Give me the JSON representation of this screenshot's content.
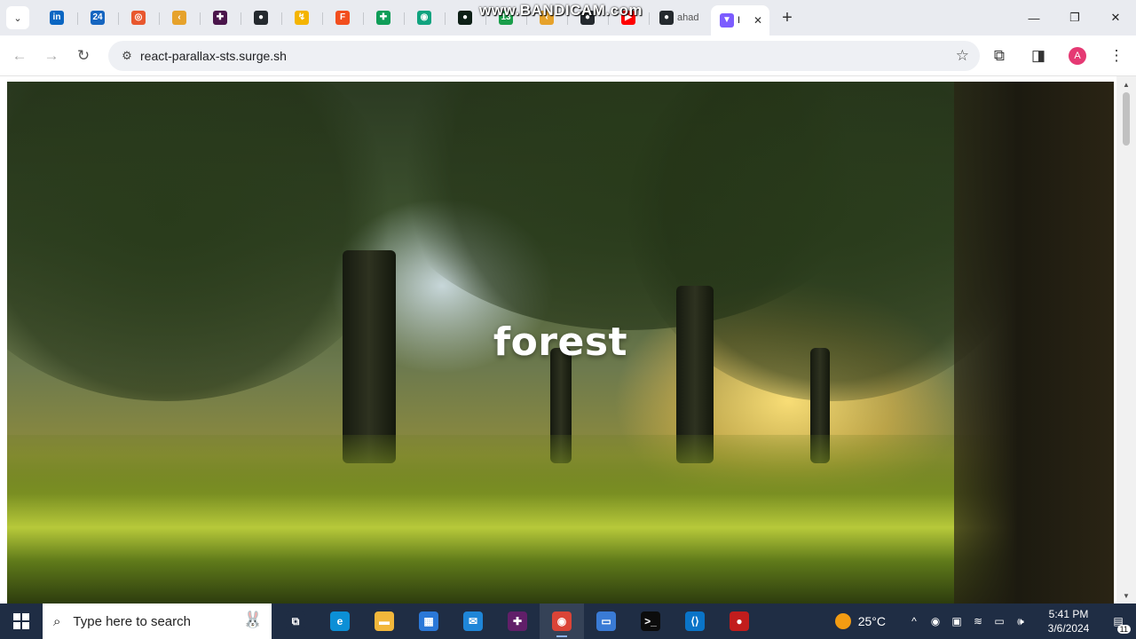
{
  "browser": {
    "pinned_tabs": [
      {
        "name": "linkedin",
        "glyph": "in",
        "color": "#0a66c2"
      },
      {
        "name": "24",
        "glyph": "24",
        "color": "#1565c0"
      },
      {
        "name": "app",
        "glyph": "◎",
        "color": "#e8572e"
      },
      {
        "name": "codeium",
        "glyph": "‹",
        "color": "#e6a22b"
      },
      {
        "name": "slack",
        "glyph": "✚",
        "color": "#4a154b"
      },
      {
        "name": "github",
        "glyph": "●",
        "color": "#24292e"
      },
      {
        "name": "bolt",
        "glyph": "↯",
        "color": "#f4b400"
      },
      {
        "name": "figma",
        "glyph": "F",
        "color": "#f24e1e"
      },
      {
        "name": "plus",
        "glyph": "✚",
        "color": "#0f9d58"
      },
      {
        "name": "chatgpt",
        "glyph": "◉",
        "color": "#10a37f"
      },
      {
        "name": "leaf",
        "glyph": "●",
        "color": "#0d1f16"
      }
    ],
    "hidden_tabs": [
      {
        "name": "app2",
        "glyph": "◐",
        "color": "#c59a1a"
      },
      {
        "name": "app3",
        "glyph": "◐",
        "color": "#2b74d5"
      },
      {
        "name": "app4",
        "glyph": "●",
        "color": "#17a05d"
      }
    ],
    "trailing_tabs": [
      {
        "name": "badge",
        "glyph": "13",
        "color": "#1a9e4b"
      },
      {
        "name": "codeium2",
        "glyph": "‹",
        "color": "#e6a22b"
      },
      {
        "name": "github2",
        "glyph": "●",
        "color": "#24292e"
      },
      {
        "name": "youtube",
        "glyph": "▶",
        "color": "#ff0000"
      }
    ],
    "named_tab": {
      "title": "ahad",
      "glyph": "●",
      "color": "#24292e"
    },
    "active_tab": {
      "title": "I",
      "glyph": "▼",
      "color": "#7c5cff"
    },
    "new_tab_label": "+",
    "window_controls": {
      "minimize": "—",
      "restore": "❐",
      "close": "✕"
    },
    "tab_search_glyph": "⌄",
    "close_tab_glyph": "✕",
    "url": "react-parallax-sts.surge.sh",
    "profile_initial": "A",
    "nav": {
      "back": "←",
      "forward": "→",
      "reload": "↻",
      "site_info": "⚙",
      "star": "☆",
      "extensions": "⧉",
      "sidepanel": "◨",
      "menu": "⋮"
    }
  },
  "watermark": "www.BANDICAM.com",
  "page": {
    "hero_title": "forest"
  },
  "scrollbar": {
    "up": "▲",
    "down": "▼"
  },
  "taskbar": {
    "search_placeholder": "Type here to search",
    "search_glyph": "⌕",
    "search_decoration": "🐰",
    "apps": [
      {
        "name": "task-view",
        "glyph": "⧉",
        "color": "#1f2d44",
        "running": false,
        "active": false
      },
      {
        "name": "edge",
        "glyph": "e",
        "color": "#0c8fd6",
        "running": false,
        "active": false
      },
      {
        "name": "file-explorer",
        "glyph": "▬",
        "color": "#f2b73b",
        "running": false,
        "active": false
      },
      {
        "name": "ms-store",
        "glyph": "▦",
        "color": "#2b78d8",
        "running": false,
        "active": false
      },
      {
        "name": "mail",
        "glyph": "✉",
        "color": "#1f86d8",
        "running": false,
        "active": false
      },
      {
        "name": "slack",
        "glyph": "✚",
        "color": "#611f69",
        "running": false,
        "active": false
      },
      {
        "name": "chrome",
        "glyph": "◉",
        "color": "#db4437",
        "running": true,
        "active": true
      },
      {
        "name": "explorer-window",
        "glyph": "▭",
        "color": "#3a7bd5",
        "running": false,
        "active": false
      },
      {
        "name": "terminal",
        "glyph": ">_",
        "color": "#0c0c0c",
        "running": false,
        "active": false
      },
      {
        "name": "vscode",
        "glyph": "⟨⟩",
        "color": "#0a74c8",
        "running": false,
        "active": false
      },
      {
        "name": "bandicam",
        "glyph": "●",
        "color": "#c21d1d",
        "running": false,
        "active": false
      }
    ],
    "weather_temp": "25°C",
    "tray_icons": [
      {
        "name": "chevron-up",
        "glyph": "^"
      },
      {
        "name": "record",
        "glyph": "◉"
      },
      {
        "name": "display",
        "glyph": "▣"
      },
      {
        "name": "wifi",
        "glyph": "≋"
      },
      {
        "name": "battery",
        "glyph": "▭"
      },
      {
        "name": "volume",
        "glyph": "🕪"
      }
    ],
    "time": "5:41 PM",
    "date": "3/6/2024",
    "notification_glyph": "▤",
    "notification_count": "11"
  }
}
